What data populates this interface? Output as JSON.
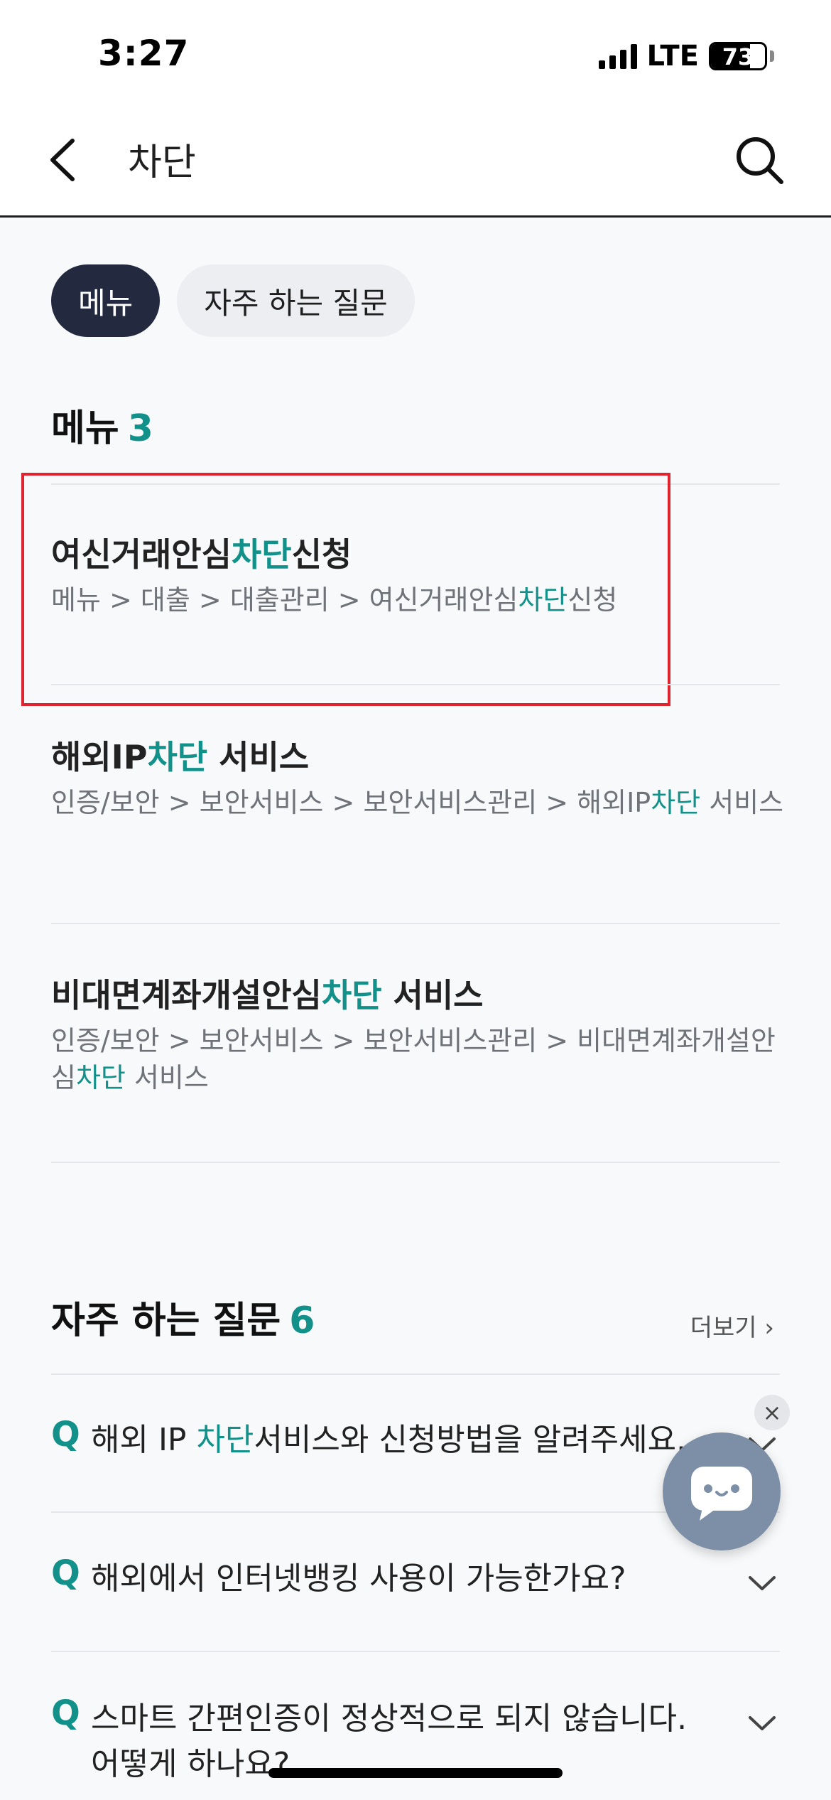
{
  "status_bar": {
    "time": "3:27",
    "network": "LTE",
    "battery": "73",
    "battery_level": 0.73
  },
  "header": {
    "title": "차단"
  },
  "tabs": [
    {
      "label": "메뉴",
      "active": true
    },
    {
      "label": "자주 하는 질문",
      "active": false
    }
  ],
  "menu_section": {
    "title": "메뉴",
    "count": "3",
    "items": [
      {
        "title_before": "여신거래안심",
        "title_hl": "차단",
        "title_after": "신청",
        "path_before": "메뉴 > 대출 > 대출관리 > 여신거래안심",
        "path_hl": "차단",
        "path_after": "신청"
      },
      {
        "title_before": "해외IP",
        "title_hl": "차단",
        "title_after": " 서비스",
        "path_before": "인증/보안 > 보안서비스 > 보안서비스관리 > 해외IP",
        "path_hl": "차단",
        "path_after": " 서비스"
      },
      {
        "title_before": "비대면계좌개설안심",
        "title_hl": "차단",
        "title_after": " 서비스",
        "path_before": "인증/보안 > 보안서비스 > 보안서비스관리 > 비대면계좌개설안심",
        "path_hl": "차단",
        "path_after": " 서비스"
      }
    ]
  },
  "faq_section": {
    "title": "자주 하는 질문",
    "count": "6",
    "more_label": "더보기 ›",
    "q_marker": "Q",
    "items": [
      {
        "before": "해외 IP ",
        "hl": "차단",
        "after": "서비스와 신청방법을 알려주세요."
      },
      {
        "before": "해외에서 인터넷뱅킹 사용이 가능한가요?",
        "hl": "",
        "after": ""
      },
      {
        "before": "스마트 간편인증이 정상적으로 되지 않습니다. 어떻게 하나요?",
        "hl": "",
        "after": ""
      }
    ]
  },
  "chatbot": {
    "close_label": "×"
  },
  "colors": {
    "accent": "#12918a",
    "chip_active": "#232a40",
    "highlight_box": "#e0242f",
    "chatbot": "#7d8fa6"
  }
}
